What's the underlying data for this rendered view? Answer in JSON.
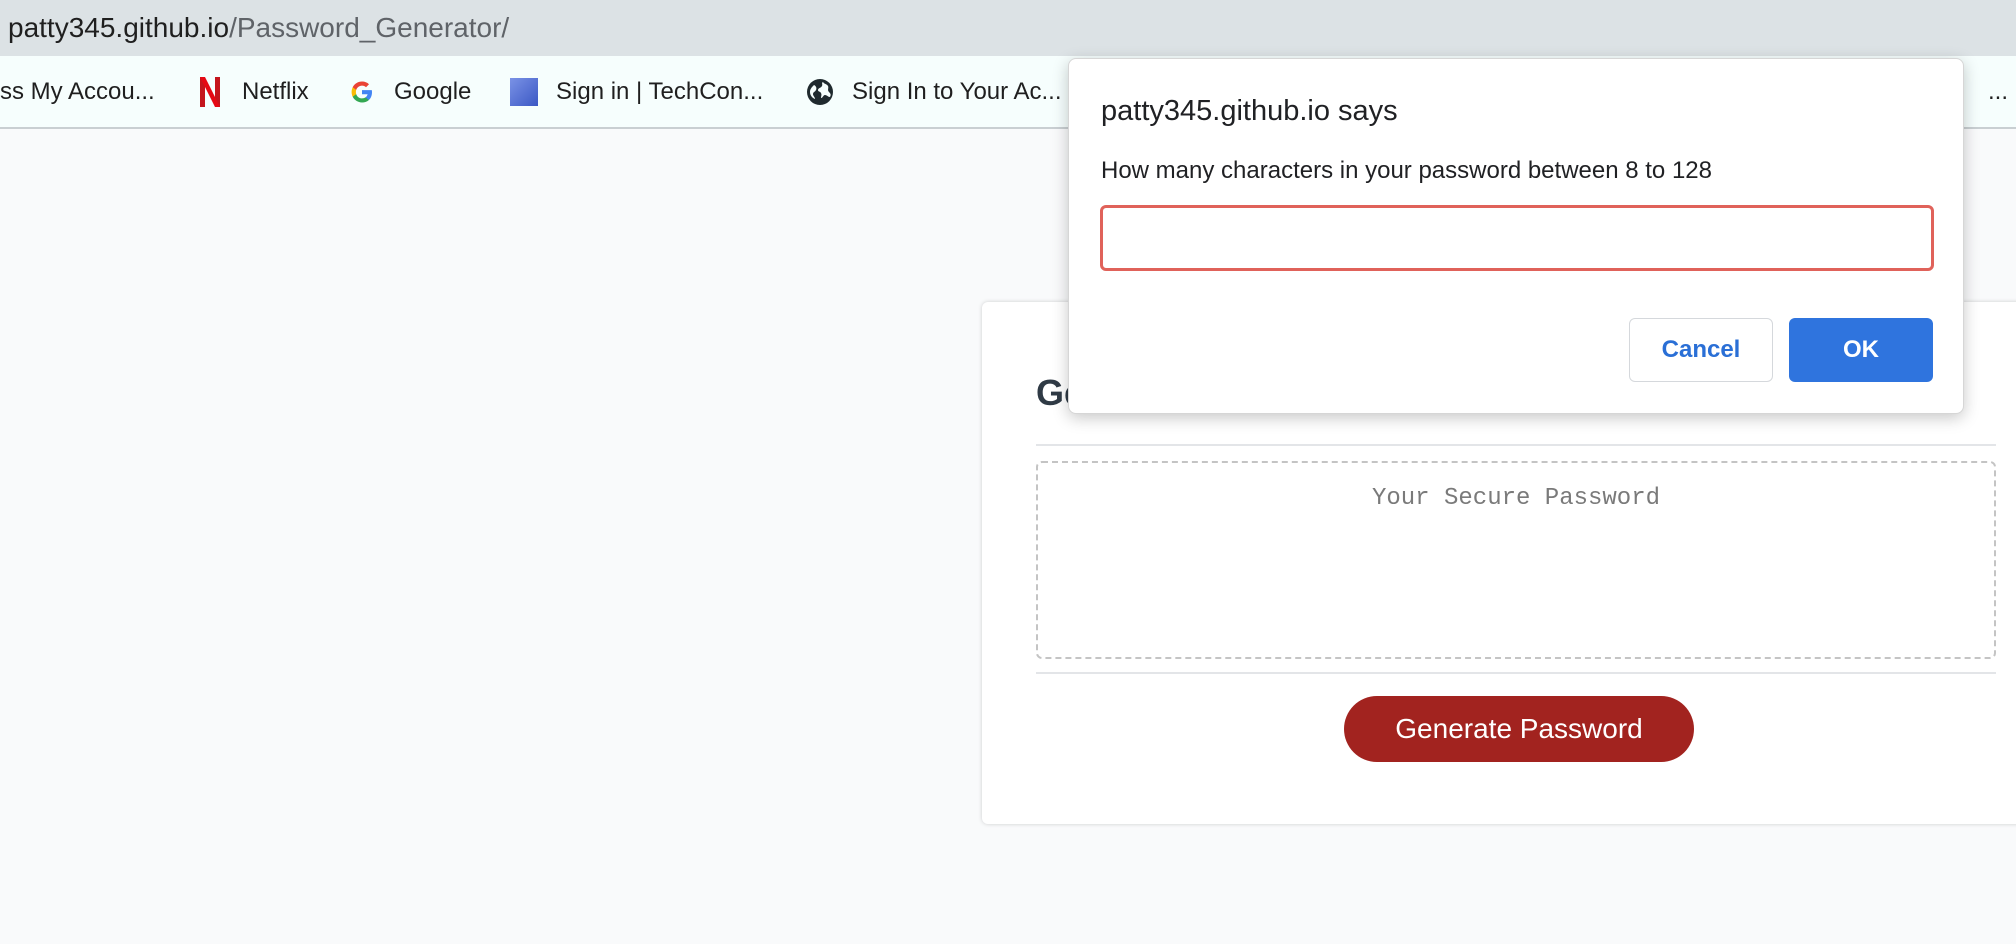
{
  "browser": {
    "url_host": "patty345.github.io",
    "url_path": "/Password_Generator/"
  },
  "bookmarks": [
    {
      "label": "ss My Accou...",
      "icon": "none"
    },
    {
      "label": "Netflix",
      "icon": "netflix-icon"
    },
    {
      "label": "Google",
      "icon": "google-icon"
    },
    {
      "label": "Sign in | TechCon...",
      "icon": "techcon-icon"
    },
    {
      "label": "Sign In to Your Ac...",
      "icon": "globe-icon"
    },
    {
      "label": "...",
      "icon": "none"
    }
  ],
  "page": {
    "card_title_visible": "Ge",
    "password_placeholder": "Your Secure Password",
    "generate_button": "Generate Password"
  },
  "dialog": {
    "title": "patty345.github.io says",
    "message": "How many characters in your password between 8 to 128",
    "input_value": "",
    "cancel_label": "Cancel",
    "ok_label": "OK"
  },
  "colors": {
    "generate_button": "#a2231f",
    "ok_button": "#2f74de",
    "input_focus_border": "#e0625a"
  }
}
